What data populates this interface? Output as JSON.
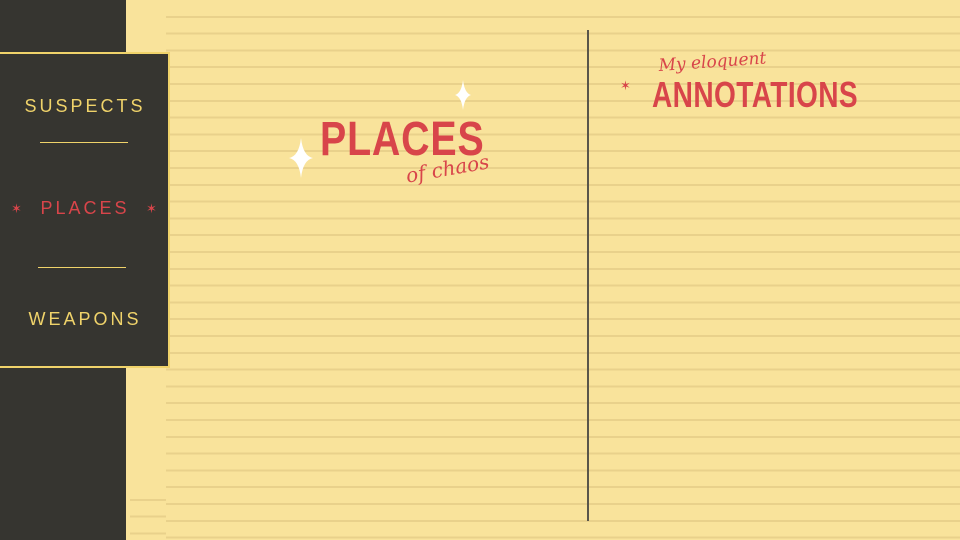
{
  "nav": {
    "items": [
      {
        "label": "SUSPECTS",
        "active": false
      },
      {
        "label": "PLACES",
        "active": true
      },
      {
        "label": "WEAPONS",
        "active": false
      }
    ]
  },
  "left_heading": {
    "title": "PLACES",
    "subtitle": "of chaos"
  },
  "right_heading": {
    "pretitle": "My eloquent",
    "title": "ANNOTATIONS"
  },
  "colors": {
    "paper": "#f9e39b",
    "rule": "#e9d18b",
    "panel": "#363530",
    "accent_yellow": "#f0d36a",
    "accent_red": "#d8454a",
    "sparkle": "#ffffff"
  },
  "icons": [
    "star-icon",
    "sparkle-icon"
  ]
}
